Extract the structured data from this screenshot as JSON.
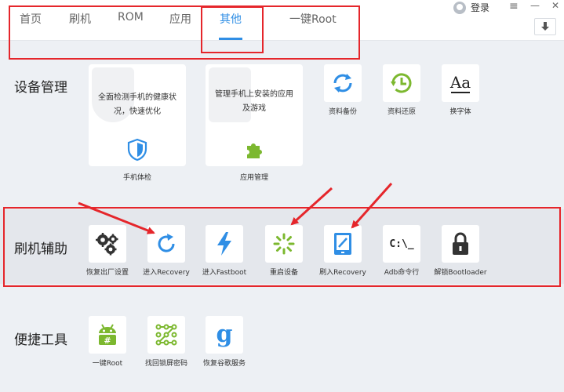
{
  "tabs": [
    {
      "label": "首页"
    },
    {
      "label": "刷机"
    },
    {
      "label": "ROM"
    },
    {
      "label": "应用"
    },
    {
      "label": "其他"
    },
    {
      "label": "一键Root"
    }
  ],
  "active_tab": "其他",
  "header": {
    "login_label": "登录",
    "menu_glyph": "≡",
    "minimize_glyph": "—",
    "close_glyph": "✕"
  },
  "sections": {
    "device": {
      "title": "设备管理",
      "big_cards": [
        {
          "desc": "全面检测手机的健康状况，快速优化",
          "label": "手机体检",
          "icon": "shield-icon"
        },
        {
          "desc": "管理手机上安装的应用及游戏",
          "label": "应用管理",
          "icon": "puzzle-icon"
        }
      ],
      "tiles": [
        {
          "label": "资料备份",
          "icon": "sync-icon"
        },
        {
          "label": "资料还原",
          "icon": "clock-restore-icon"
        },
        {
          "label": "换字体",
          "icon": "font-icon",
          "glyph": "Aa"
        }
      ]
    },
    "flash": {
      "title": "刷机辅助",
      "tiles": [
        {
          "label": "恢复出厂设置",
          "icon": "gears-icon"
        },
        {
          "label": "进入Recovery",
          "icon": "refresh-icon"
        },
        {
          "label": "进入Fastboot",
          "icon": "lightning-icon"
        },
        {
          "label": "重启设备",
          "icon": "loading-icon"
        },
        {
          "label": "刷入Recovery",
          "icon": "tablet-edit-icon"
        },
        {
          "label": "Adb命令行",
          "icon": "terminal-icon",
          "glyph": "C:\\_"
        },
        {
          "label": "解锁Bootloader",
          "icon": "lock-icon"
        }
      ]
    },
    "tools": {
      "title": "便捷工具",
      "tiles": [
        {
          "label": "一键Root",
          "icon": "android-icon"
        },
        {
          "label": "找回锁屏密码",
          "icon": "pattern-lock-icon"
        },
        {
          "label": "恢复谷歌服务",
          "icon": "google-icon",
          "glyph": "g"
        }
      ]
    }
  },
  "colors": {
    "accent": "#2f8ee5",
    "highlight_red": "#e5262b",
    "android_green": "#7cb82f",
    "background": "#edf0f4"
  }
}
